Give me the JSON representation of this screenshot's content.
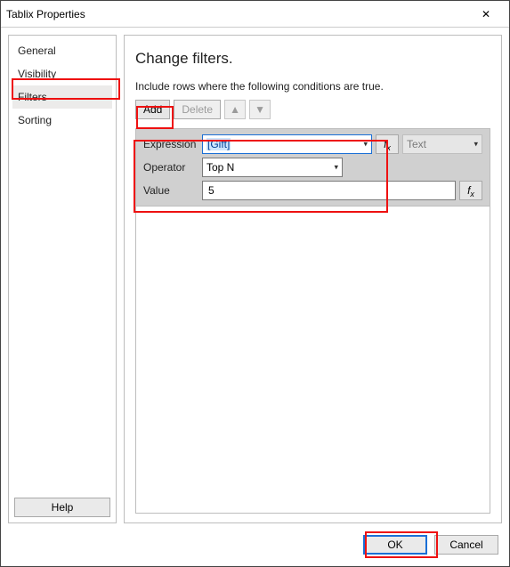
{
  "window": {
    "title": "Tablix Properties"
  },
  "sidebar": {
    "items": [
      {
        "label": "General"
      },
      {
        "label": "Visibility"
      },
      {
        "label": "Filters"
      },
      {
        "label": "Sorting"
      }
    ],
    "help_label": "Help"
  },
  "page": {
    "title": "Change filters.",
    "instruction": "Include rows where the following conditions are true."
  },
  "toolbar": {
    "add_label": "Add",
    "delete_label": "Delete"
  },
  "filter": {
    "expression_label": "Expression",
    "expression_value": "[Gift]",
    "operator_label": "Operator",
    "operator_value": "Top N",
    "value_label": "Value",
    "value_value": "5",
    "type_hint": "Text"
  },
  "footer": {
    "ok_label": "OK",
    "cancel_label": "Cancel"
  }
}
